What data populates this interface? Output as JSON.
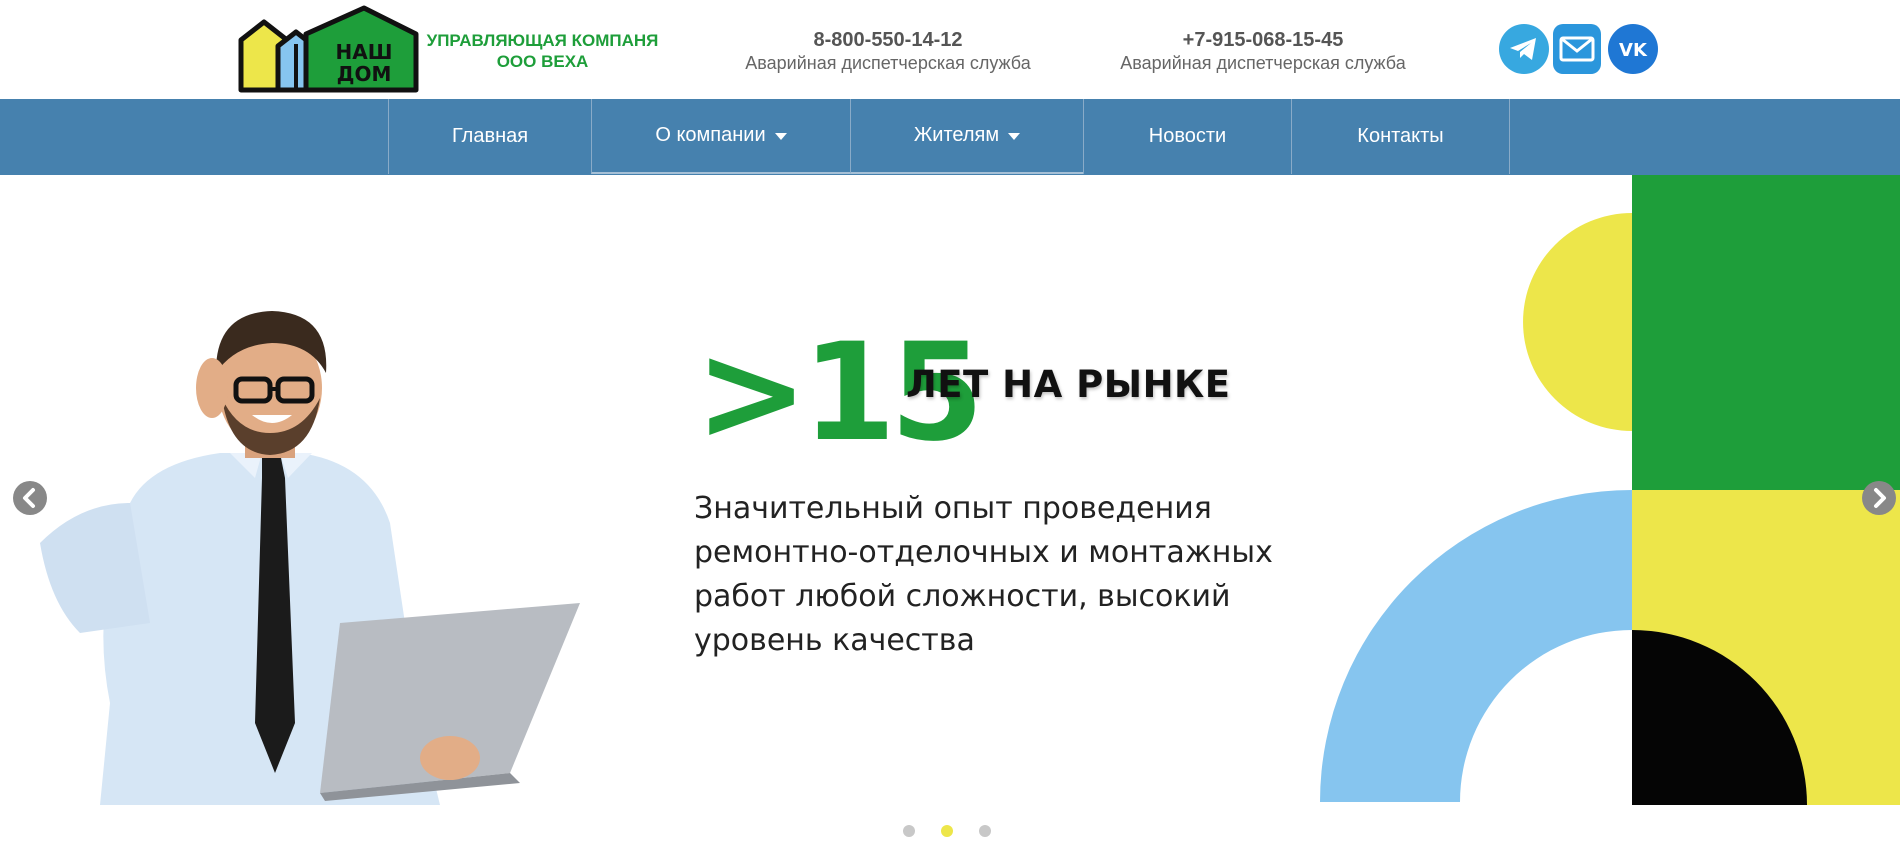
{
  "header": {
    "logo_text_1": "НАШ",
    "logo_text_2": "ДОМ",
    "company_line1": "УПРАВЛЯЮЩАЯ КОМПАНЯ",
    "company_line2": "ООО ВЕХА",
    "contacts": [
      {
        "phone": "8-800-550-14-12",
        "desc": "Аварийная диспетчерская служба"
      },
      {
        "phone": "+7-915-068-15-45",
        "desc": "Аварийная диспетчерская служба"
      }
    ],
    "social": [
      "telegram-icon",
      "mail-icon",
      "vk-icon"
    ]
  },
  "nav": {
    "items": [
      {
        "label": "Главная",
        "dropdown": false
      },
      {
        "label": "О компании",
        "dropdown": true
      },
      {
        "label": "Жителям",
        "dropdown": true
      },
      {
        "label": "Новости",
        "dropdown": false
      },
      {
        "label": "Контакты",
        "dropdown": false
      }
    ]
  },
  "slide": {
    "big_number": ">15",
    "heading": "ЛЕТ НА РЫНКЕ",
    "text": "Значительный опыт проведения ремонтно-отделочных и монтажных работ любой сложности, высокий уровень качества"
  },
  "slider": {
    "dots": 3,
    "active_dot": 2
  },
  "colors": {
    "brand_green": "#1e9e3a",
    "nav_blue": "#4681ae",
    "accent_yellow": "#ede64a",
    "light_blue": "#86c5ef"
  }
}
